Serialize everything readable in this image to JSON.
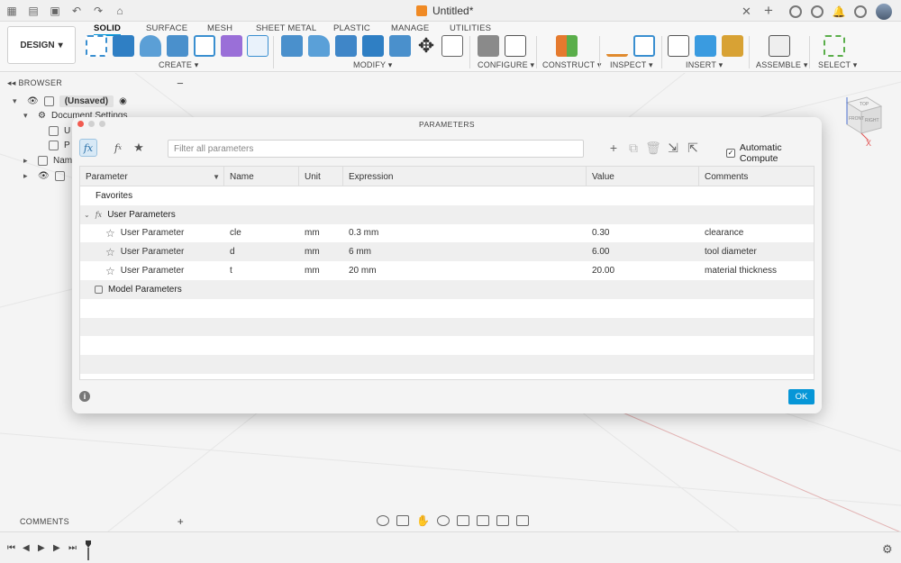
{
  "titlebar": {
    "doc_title": "Untitled*",
    "icons": [
      "grid-icon",
      "file-icon",
      "save-icon",
      "undo-icon",
      "redo-icon",
      "home-icon",
      "close-icon",
      "add-tab-icon",
      "extensions-icon",
      "job-status-icon",
      "notifications-icon",
      "help-icon",
      "user-avatar"
    ]
  },
  "ribbon": {
    "workspace": "DESIGN",
    "tabs": [
      "SOLID",
      "SURFACE",
      "MESH",
      "SHEET METAL",
      "PLASTIC",
      "MANAGE",
      "UTILITIES"
    ],
    "active_tab": "SOLID",
    "groups": [
      "CREATE",
      "MODIFY",
      "CONFIGURE",
      "CONSTRUCT",
      "INSPECT",
      "INSERT",
      "ASSEMBLE",
      "SELECT"
    ]
  },
  "browser": {
    "title": "BROWSER",
    "root": "(Unsaved)",
    "document_settings": "Document Settings",
    "child_u": "U",
    "child_p": "P",
    "named_views": "Nam"
  },
  "viewcube": {
    "top": "TOP",
    "front": "FRONT",
    "right": "RIGHT",
    "z_axis": "Z",
    "x_axis": "X"
  },
  "dialog": {
    "title": "PARAMETERS",
    "search_placeholder": "Filter all parameters",
    "auto_compute_label": "Automatic Compute",
    "auto_compute_checked": true,
    "columns": [
      "Parameter",
      "Name",
      "Unit",
      "Expression",
      "Value",
      "Comments"
    ],
    "favorites_label": "Favorites",
    "user_group_label": "User Parameters",
    "model_group_label": "Model Parameters",
    "rows": [
      {
        "parameter": "User Parameter",
        "name": "cle",
        "unit": "mm",
        "expression": "0.3 mm",
        "value": "0.30",
        "comment": "clearance"
      },
      {
        "parameter": "User Parameter",
        "name": "d",
        "unit": "mm",
        "expression": "6 mm",
        "value": "6.00",
        "comment": "tool diameter"
      },
      {
        "parameter": "User Parameter",
        "name": "t",
        "unit": "mm",
        "expression": "20 mm",
        "value": "20.00",
        "comment": "material thickness"
      }
    ],
    "ok_label": "OK"
  },
  "bottom": {
    "comments_label": "COMMENTS"
  },
  "colors": {
    "accent": "#0696d7",
    "doc_icon": "#f08a24",
    "close_light": "#f15b50"
  }
}
